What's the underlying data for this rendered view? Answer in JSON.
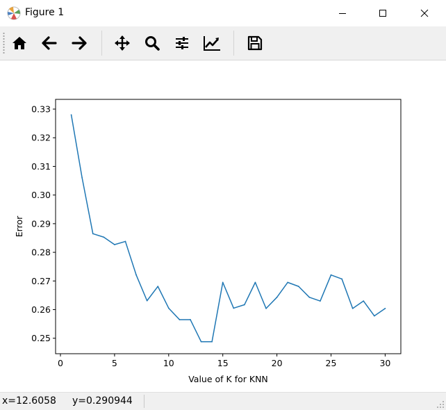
{
  "window": {
    "title": "Figure 1",
    "icon": "matplotlib-logo-icon",
    "controls": [
      "minimize-icon",
      "maximize-icon",
      "close-icon"
    ]
  },
  "toolbar": {
    "buttons": [
      {
        "name": "home-button",
        "icon": "home-icon"
      },
      {
        "name": "back-button",
        "icon": "arrow-left-icon"
      },
      {
        "name": "forward-button",
        "icon": "arrow-right-icon"
      },
      {
        "name": "pan-button",
        "icon": "move-icon"
      },
      {
        "name": "zoom-button",
        "icon": "magnifier-icon"
      },
      {
        "name": "subplots-button",
        "icon": "sliders-icon"
      },
      {
        "name": "edit-axis-button",
        "icon": "line-chart-icon"
      },
      {
        "name": "save-button",
        "icon": "floppy-disk-icon"
      }
    ]
  },
  "status": {
    "x_readout": "x=12.6058",
    "y_readout": "y=0.290944"
  },
  "chart_data": {
    "type": "line",
    "title": "",
    "xlabel": "Value of K for KNN",
    "ylabel": "Error",
    "xlim": [
      -0.45,
      31.45
    ],
    "ylim": [
      0.2446,
      0.3334
    ],
    "xticks": [
      "0",
      "5",
      "10",
      "15",
      "20",
      "25",
      "30"
    ],
    "yticks": [
      "0.25",
      "0.26",
      "0.27",
      "0.28",
      "0.29",
      "0.30",
      "0.31",
      "0.32",
      "0.33"
    ],
    "grid": false,
    "line_color": "#1f77b4",
    "series": [
      {
        "x": [
          1,
          2,
          3,
          4,
          5,
          6,
          7,
          8,
          9,
          10,
          11,
          12,
          13,
          14,
          15,
          16,
          17,
          18,
          19,
          20,
          21,
          22,
          23,
          24,
          25,
          26,
          27,
          28,
          29,
          30
        ],
        "values": [
          0.328,
          0.306,
          0.2865,
          0.2853,
          0.2827,
          0.2838,
          0.2721,
          0.2631,
          0.2681,
          0.2605,
          0.2565,
          0.2565,
          0.2488,
          0.2488,
          0.2695,
          0.2605,
          0.2617,
          0.2695,
          0.2604,
          0.2643,
          0.2695,
          0.2681,
          0.2643,
          0.263,
          0.2721,
          0.2707,
          0.2604,
          0.263,
          0.2578,
          0.2604
        ]
      }
    ]
  }
}
